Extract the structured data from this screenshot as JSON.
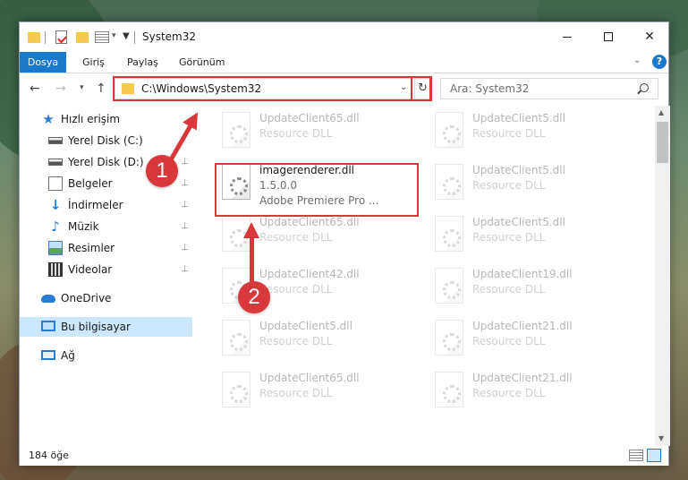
{
  "window": {
    "title": "System32",
    "minimize_label": "",
    "maximize_label": "",
    "close_label": "✕"
  },
  "ribbon": {
    "tabs": [
      "Dosya",
      "Giriş",
      "Paylaş",
      "Görünüm"
    ],
    "help_label": "?"
  },
  "nav": {
    "address": "C:\\Windows\\System32",
    "search_placeholder": "Ara: System32"
  },
  "sidebar": {
    "items": [
      {
        "label": "Hızlı erişim",
        "icon": "star-icon",
        "pinned": false
      },
      {
        "label": "Yerel Disk (C:)",
        "icon": "drive-icon",
        "pinned": false
      },
      {
        "label": "Yerel Disk (D:)",
        "icon": "drive-icon",
        "pinned": true
      },
      {
        "label": "Belgeler",
        "icon": "documents-icon",
        "pinned": true
      },
      {
        "label": "İndirmeler",
        "icon": "downloads-icon",
        "pinned": true
      },
      {
        "label": "Müzik",
        "icon": "music-icon",
        "pinned": true
      },
      {
        "label": "Resimler",
        "icon": "pictures-icon",
        "pinned": true
      },
      {
        "label": "Videolar",
        "icon": "videos-icon",
        "pinned": true
      },
      {
        "label": "OneDrive",
        "icon": "cloud-icon",
        "pinned": false
      },
      {
        "label": "Bu bilgisayar",
        "icon": "computer-icon",
        "pinned": false,
        "selected": true
      },
      {
        "label": "Ağ",
        "icon": "network-icon",
        "pinned": false
      }
    ]
  },
  "files": {
    "items": [
      {
        "name": "UpdateClient65.dll",
        "type": "Resource DLL",
        "faded": true
      },
      {
        "name": "UpdateClient5.dll",
        "type": "Resource DLL",
        "faded": true
      },
      {
        "name": "imagerenderer.dll",
        "version": "1.5.0.0",
        "company": "Adobe Premiere Pro ...",
        "faded": false,
        "highlighted": true
      },
      {
        "name": "UpdateClient5.dll",
        "type": "Resource DLL",
        "faded": true
      },
      {
        "name": "UpdateClient65.dll",
        "type": "Resource DLL",
        "faded": true
      },
      {
        "name": "UpdateClient5.dll",
        "type": "Resource DLL",
        "faded": true
      },
      {
        "name": "UpdateClient42.dll",
        "type": "Resource DLL",
        "faded": true
      },
      {
        "name": "UpdateClient19.dll",
        "type": "Resource DLL",
        "faded": true
      },
      {
        "name": "UpdateClient5.dll",
        "type": "Resource DLL",
        "faded": true
      },
      {
        "name": "UpdateClient21.dll",
        "type": "Resource DLL",
        "faded": true
      },
      {
        "name": "UpdateClient65.dll",
        "type": "Resource DLL",
        "faded": true
      },
      {
        "name": "UpdateClient21.dll",
        "type": "Resource DLL",
        "faded": true
      }
    ]
  },
  "status": {
    "item_count": "184 öğe"
  },
  "annotations": {
    "step1": "1",
    "step2": "2",
    "color": "#d9383b"
  },
  "colors": {
    "accent": "#1979ca",
    "selection": "#cce8ff",
    "folder": "#f4c94f"
  }
}
